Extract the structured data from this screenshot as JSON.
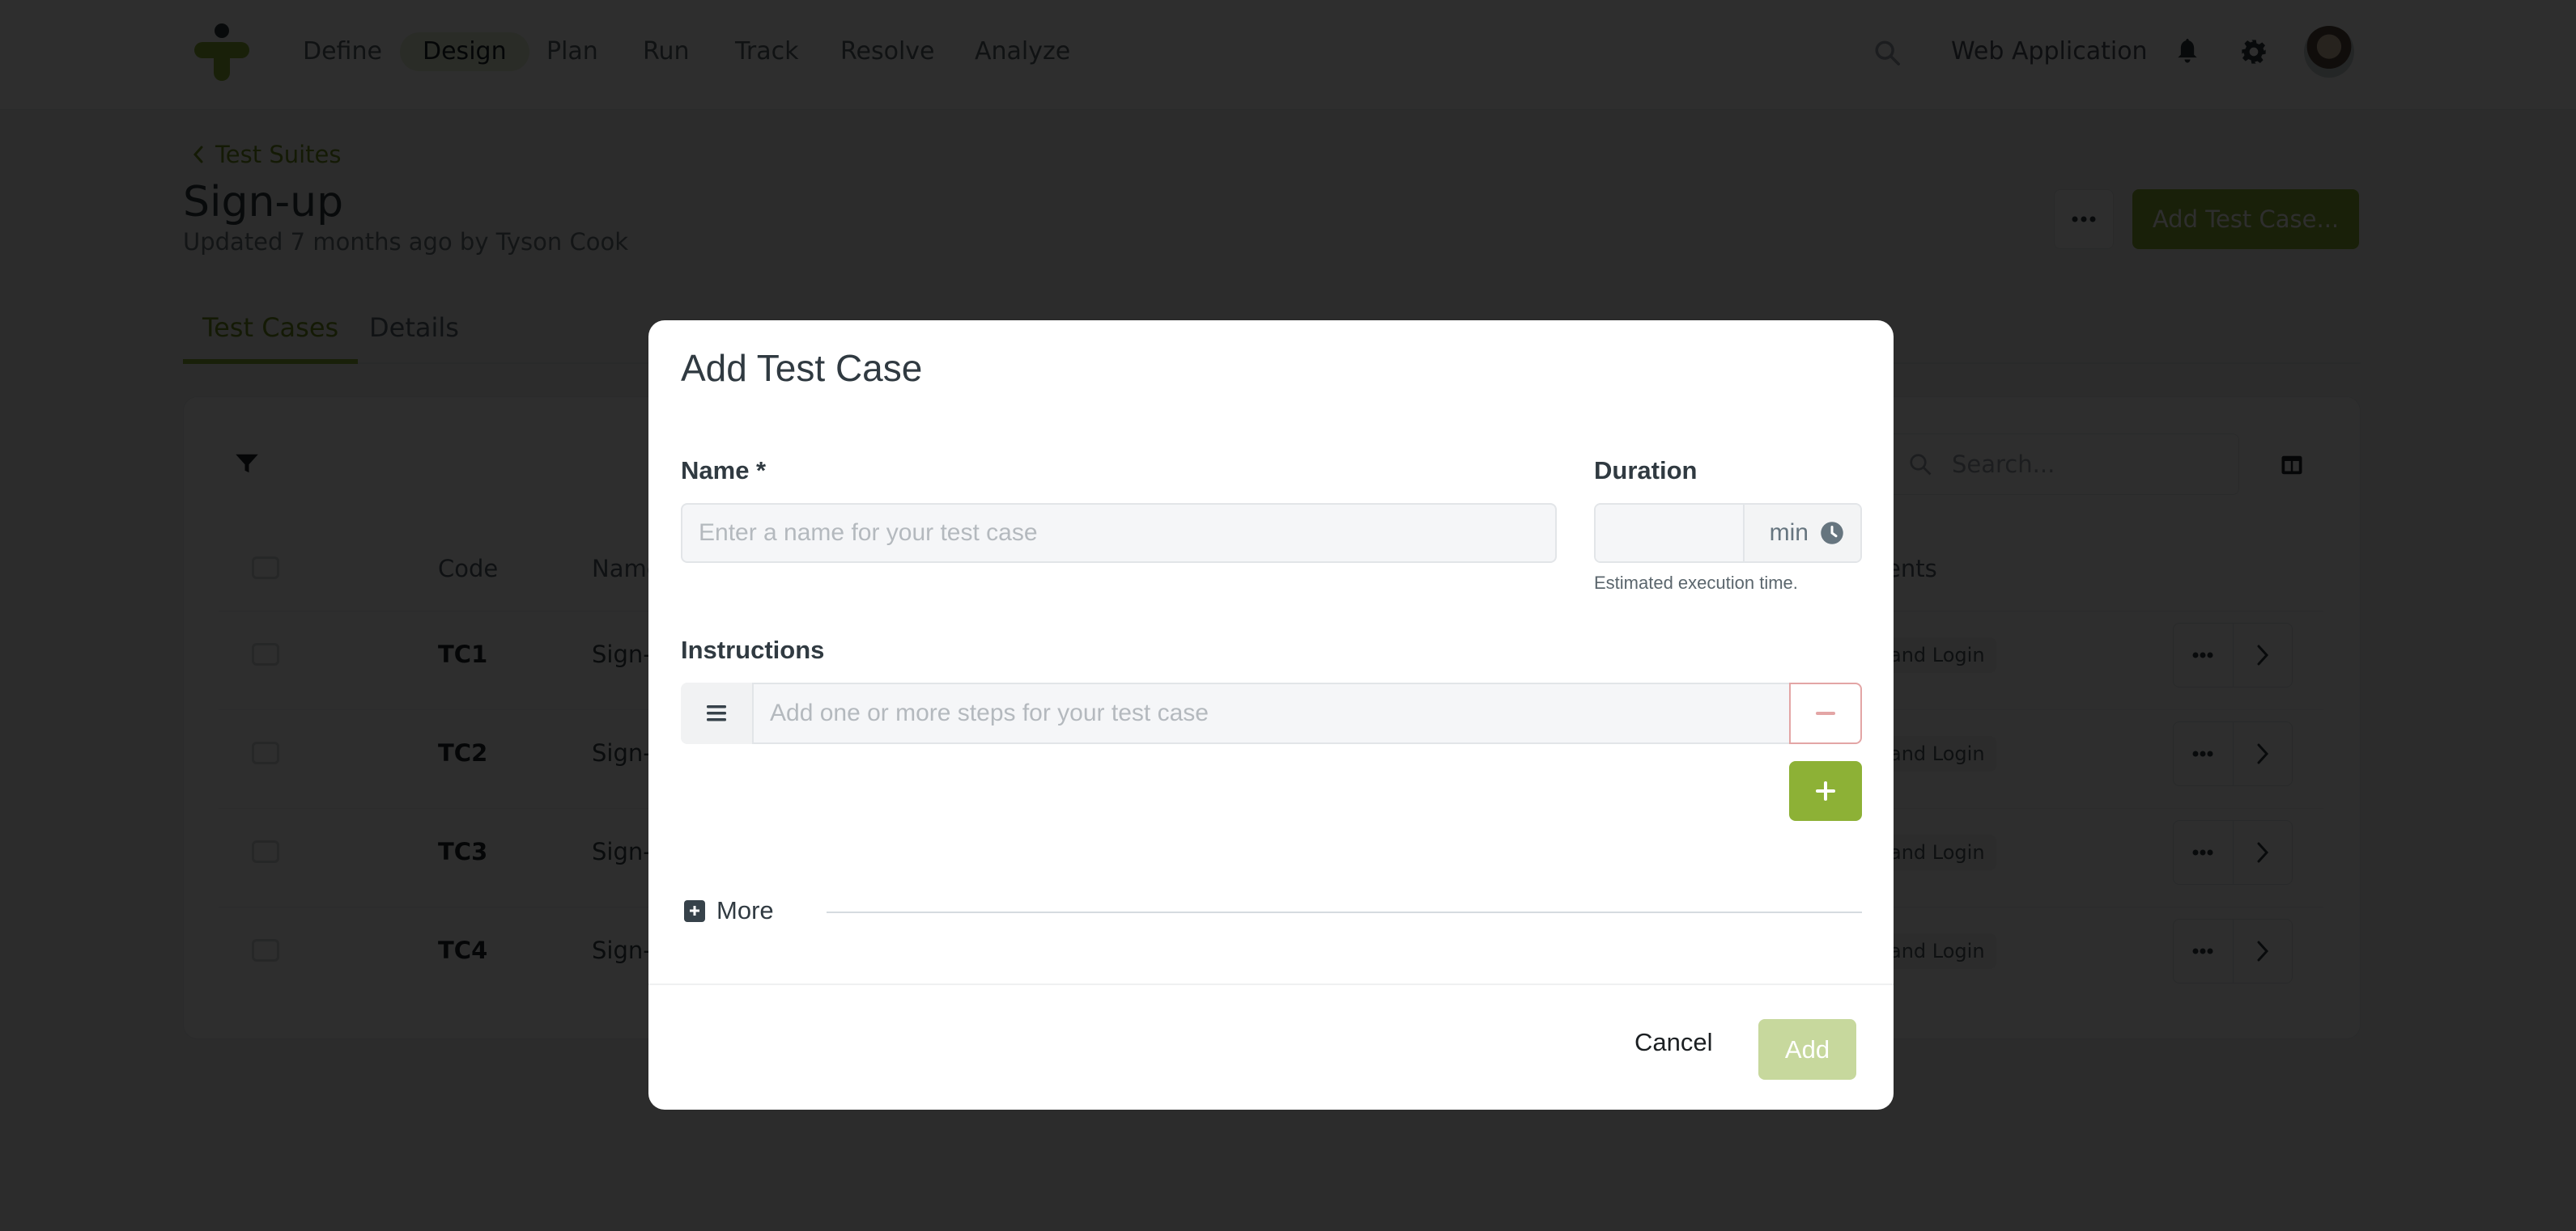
{
  "topnav": {
    "items": [
      {
        "label": "Define",
        "active": false
      },
      {
        "label": "Design",
        "active": true
      },
      {
        "label": "Plan",
        "active": false
      },
      {
        "label": "Run",
        "active": false
      },
      {
        "label": "Track",
        "active": false
      },
      {
        "label": "Resolve",
        "active": false
      },
      {
        "label": "Analyze",
        "active": false
      }
    ],
    "project": "Web Application",
    "icons": [
      "search-icon",
      "bell-icon",
      "gear-icon",
      "avatar"
    ]
  },
  "page": {
    "breadcrumb": "Test Suites",
    "title": "Sign-up",
    "subtitle": "Updated 7 months ago by Tyson Cook",
    "add_button": "Add Test Case...",
    "more_button_icon": "ellipsis-icon"
  },
  "tabs": [
    {
      "label": "Test Cases",
      "active": true
    },
    {
      "label": "Details",
      "active": false
    }
  ],
  "table": {
    "search_placeholder": "Search...",
    "columns": [
      "Code",
      "Name",
      "ents"
    ],
    "rows": [
      {
        "code": "TC1",
        "name": "Sign-",
        "tag": "and Login"
      },
      {
        "code": "TC2",
        "name": "Sign-",
        "tag": "and Login"
      },
      {
        "code": "TC3",
        "name": "Sign-",
        "tag": "and Login"
      },
      {
        "code": "TC4",
        "name": "Sign-",
        "tag": "and Login"
      }
    ]
  },
  "modal": {
    "title": "Add Test Case",
    "name_label": "Name *",
    "name_placeholder": "Enter a name for your test case",
    "name_value": "",
    "duration_label": "Duration",
    "duration_value": "",
    "duration_unit": "min",
    "duration_help": "Estimated execution time.",
    "instructions_label": "Instructions",
    "step_placeholder": "Add one or more steps for your test case",
    "more_label": "More",
    "cancel_label": "Cancel",
    "add_label": "Add",
    "add_enabled": false
  },
  "colors": {
    "accent": "#8db136",
    "accent_disabled": "#c7d89d",
    "danger_border": "#e3a5a5",
    "overlay": "rgba(0,0,0,0.82)"
  }
}
